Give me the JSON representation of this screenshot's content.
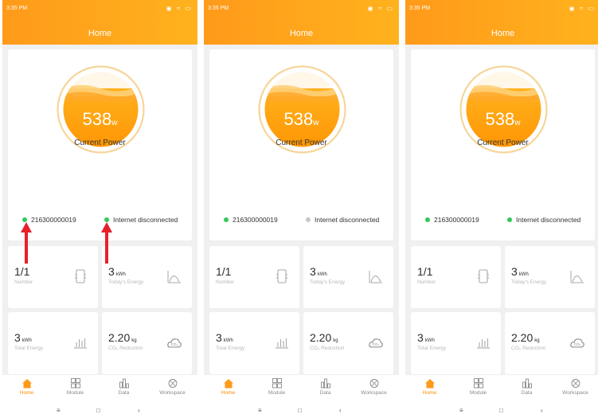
{
  "screens": [
    {
      "status_time": "3:35 PM",
      "title": "Home",
      "power_value": "538",
      "power_unit": "w",
      "power_label": "Current Power",
      "device_id": "216300000019",
      "device_status_color": "#34c759",
      "internet_label": "Internet disconnected",
      "internet_status_color": "#34c759",
      "tiles": [
        {
          "value": "1/1",
          "unit": "",
          "label": "Number",
          "icon": "device-module-icon"
        },
        {
          "value": "3",
          "unit": "kWh",
          "label": "Today's Energy",
          "icon": "energy-chart-icon"
        },
        {
          "value": "3",
          "unit": "kWh",
          "label": "Total Energy",
          "icon": "bar-chart-icon"
        },
        {
          "value": "2.20",
          "unit": "kg",
          "label": "CO₂ Reduction",
          "icon": "co2-cloud-icon"
        }
      ],
      "tabs": [
        {
          "label": "Home",
          "icon": "home-icon",
          "active": true
        },
        {
          "label": "Module",
          "icon": "grid-icon",
          "active": false
        },
        {
          "label": "Data",
          "icon": "data-icon",
          "active": false
        },
        {
          "label": "Workspace",
          "icon": "workspace-icon",
          "active": false
        }
      ],
      "nav": {
        "menu": "≡",
        "home": "□",
        "back": "‹"
      }
    },
    {
      "status_time": "3:35 PM",
      "title": "Home",
      "power_value": "538",
      "power_unit": "w",
      "power_label": "Current Power",
      "device_id": "216300000019",
      "device_status_color": "#34c759",
      "internet_label": "Internet disconnected",
      "internet_status_color": "#c8c8c8",
      "tiles": [
        {
          "value": "1/1",
          "unit": "",
          "label": "Number",
          "icon": "device-module-icon"
        },
        {
          "value": "3",
          "unit": "kWh",
          "label": "Today's Energy",
          "icon": "energy-chart-icon"
        },
        {
          "value": "3",
          "unit": "kWh",
          "label": "Total Energy",
          "icon": "bar-chart-icon"
        },
        {
          "value": "2.20",
          "unit": "kg",
          "label": "CO₂ Reduction",
          "icon": "co2-cloud-icon"
        }
      ],
      "tabs": [
        {
          "label": "Home",
          "icon": "home-icon",
          "active": true
        },
        {
          "label": "Module",
          "icon": "grid-icon",
          "active": false
        },
        {
          "label": "Data",
          "icon": "data-icon",
          "active": false
        },
        {
          "label": "Workspace",
          "icon": "workspace-icon",
          "active": false
        }
      ],
      "nav": {
        "menu": "≡",
        "home": "□",
        "back": "‹"
      }
    },
    {
      "status_time": "3:35 PM",
      "title": "Home",
      "power_value": "538",
      "power_unit": "w",
      "power_label": "Current Power",
      "device_id": "216300000019",
      "device_status_color": "#34c759",
      "internet_label": "Internet disconnected",
      "internet_status_color": "#34c759",
      "tiles": [
        {
          "value": "1/1",
          "unit": "",
          "label": "Number",
          "icon": "device-module-icon"
        },
        {
          "value": "3",
          "unit": "kWh",
          "label": "Today's Energy",
          "icon": "energy-chart-icon"
        },
        {
          "value": "3",
          "unit": "kWh",
          "label": "Total Energy",
          "icon": "bar-chart-icon"
        },
        {
          "value": "2.20",
          "unit": "kg",
          "label": "CO₂ Reduction",
          "icon": "co2-cloud-icon"
        }
      ],
      "tabs": [
        {
          "label": "Home",
          "icon": "home-icon",
          "active": true
        },
        {
          "label": "Module",
          "icon": "grid-icon",
          "active": false
        },
        {
          "label": "Data",
          "icon": "data-icon",
          "active": false
        },
        {
          "label": "Workspace",
          "icon": "workspace-icon",
          "active": false
        }
      ],
      "nav": {
        "menu": "≡",
        "home": "□",
        "back": "‹"
      }
    }
  ],
  "colors": {
    "accent": "#ff9a1a",
    "arrow": "#e8202a",
    "online": "#34c759",
    "offline": "#c8c8c8"
  }
}
